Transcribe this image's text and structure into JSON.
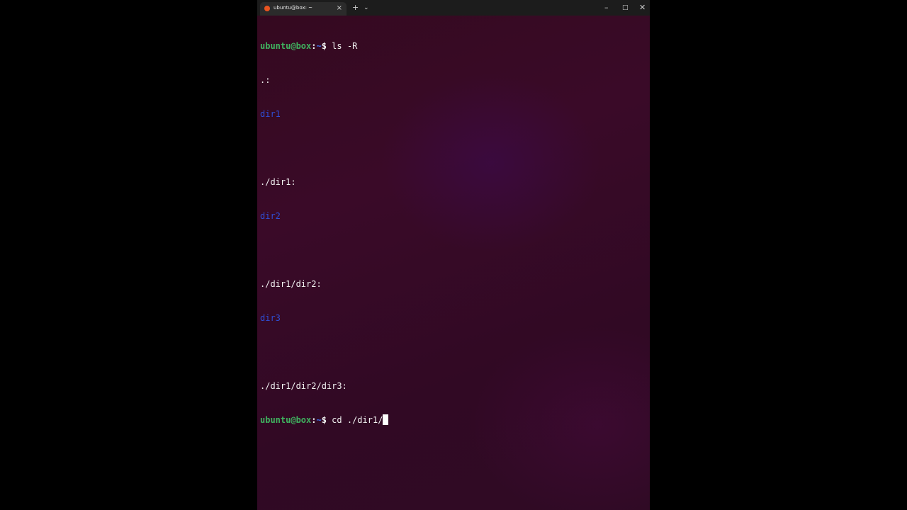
{
  "window": {
    "tab_title": "ubuntu@box: ~",
    "tab_close": "×",
    "new_tab": "+",
    "tab_dropdown": "⌄",
    "minimize": "–",
    "maximize": "□",
    "close": "✕"
  },
  "colors": {
    "terminal_bg": "#300a24",
    "prompt_user": "#3fb35f",
    "prompt_path": "#3b6ee8",
    "directory": "#2f4fd6",
    "text": "#f2f2f2"
  },
  "terminal": {
    "prompt": {
      "user_host": "ubuntu@box",
      "colon": ":",
      "path": "~",
      "symbol": "$"
    },
    "command1": " ls -R",
    "out_dot": ".:",
    "dir1": "dir1",
    "heading_dir1": "./dir1:",
    "dir2": "dir2",
    "heading_dir2": "./dir1/dir2:",
    "dir3": "dir3",
    "heading_dir3": "./dir1/dir2/dir3:",
    "command2": " cd ./dir1/"
  }
}
